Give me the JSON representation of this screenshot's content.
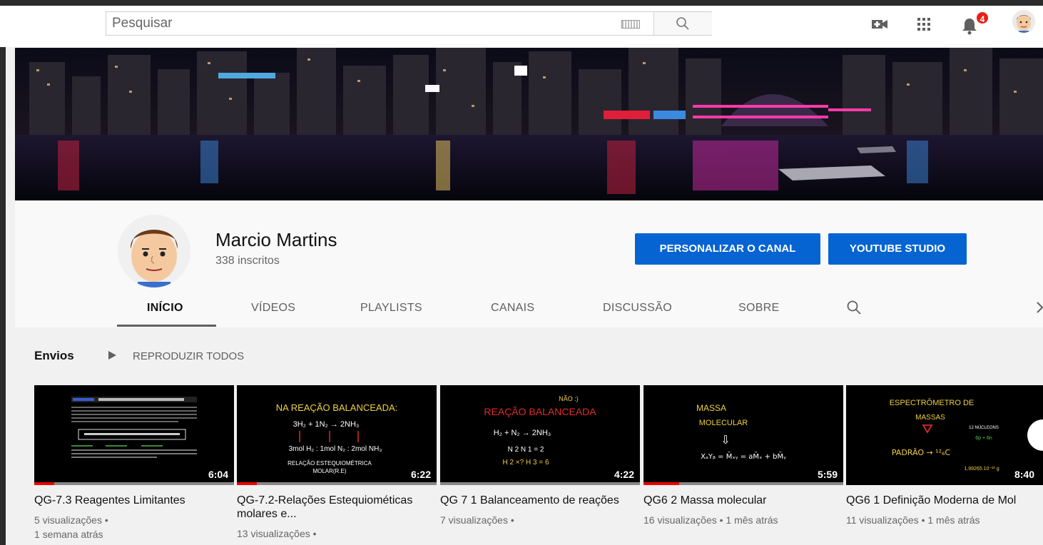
{
  "search": {
    "placeholder": "Pesquisar"
  },
  "notifications": {
    "count": "4"
  },
  "channel": {
    "name": "Marcio Martins",
    "subscribers": "338 inscritos",
    "customize_label": "PERSONALIZAR O CANAL",
    "studio_label": "YOUTUBE STUDIO"
  },
  "tabs": [
    {
      "label": "INÍCIO"
    },
    {
      "label": "VÍDEOS"
    },
    {
      "label": "PLAYLISTS"
    },
    {
      "label": "CANAIS"
    },
    {
      "label": "DISCUSSÃO"
    },
    {
      "label": "SOBRE"
    }
  ],
  "uploads": {
    "title": "Envios",
    "play_all": "REPRODUZIR TODOS",
    "videos": [
      {
        "title": "QG-7.3 Reagentes Limitantes",
        "duration": "6:04",
        "views": "5 visualizações •",
        "age": "1 semana atrás",
        "progress": 0.1
      },
      {
        "title": "QG-7.2-Relações Estequiométicas molares e...",
        "duration": "6:22",
        "views": "13 visualizações •",
        "age": "",
        "progress": 0.1,
        "thumb_text": [
          "NA REAÇÃO BALANCEADA:",
          "3H₂ + 1N₂ → 2NH₃",
          "3mol H₂ : 1mol N₂ : 2mol NH₃",
          "RELAÇÃO ESTEQUIOMÉTRICA",
          "MOLAR(R.E)"
        ]
      },
      {
        "title": "QG 7 1 Balanceamento de reações",
        "duration": "4:22",
        "views": "7 visualizações •",
        "age": "",
        "progress": 0.0,
        "thumb_text": [
          "NÃO :)",
          "REAÇÃO BALANCEADA",
          "H₂ + N₂ → 2NH₃",
          "N 2    N 1 = 2",
          "H 2 ×?   H 3 = 6"
        ]
      },
      {
        "title": "QG6 2 Massa molecular",
        "duration": "5:59",
        "views": "16 visualizações • 1 mês atrás",
        "age": "",
        "progress": 0.18,
        "thumb_text": [
          "MASSA",
          "MOLECULAR",
          "⇩",
          "XₐYᵦ = M̄ₓᵧ = aM̄ₓ + bM̄ᵧ"
        ]
      },
      {
        "title": "QG6 1 Definição Moderna de Mol",
        "duration": "8:40",
        "views": "11 visualizações • 1 mês atrás",
        "age": "",
        "progress": 0.0,
        "thumb_text": [
          "ESPECTRÔMETRO DE",
          "MASSAS",
          "12 NÚCLEONS",
          "6p + 6n",
          "PADRÃO → ¹²₆C",
          "1,99265.10⁻²³ g"
        ]
      }
    ]
  }
}
